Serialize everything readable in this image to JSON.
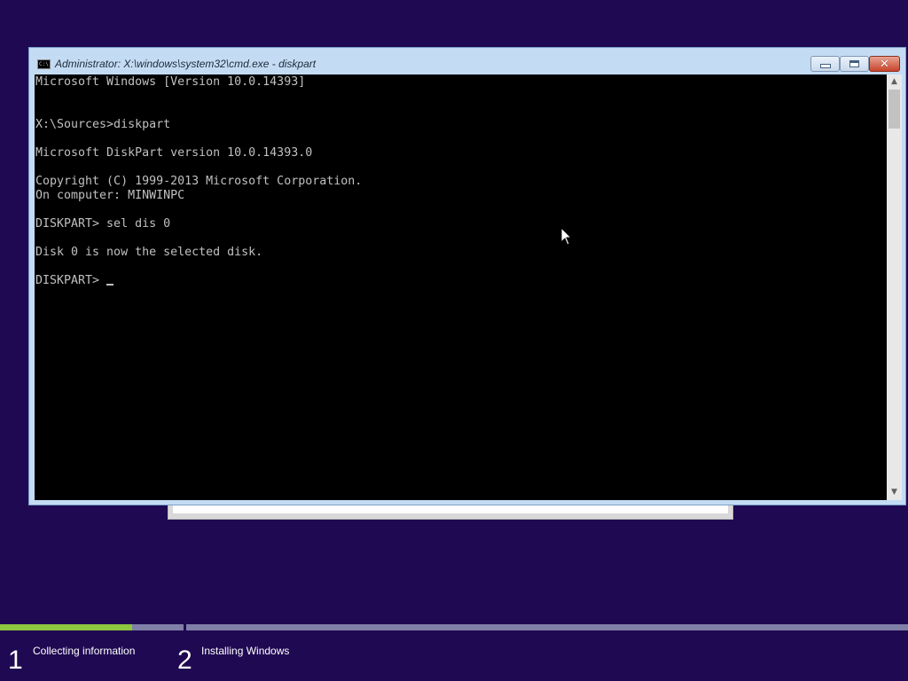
{
  "window": {
    "title": "Administrator: X:\\windows\\system32\\cmd.exe - diskpart",
    "icon": "cmd-icon",
    "icon_glyph": "C:\\"
  },
  "console": {
    "lines": [
      "Microsoft Windows [Version 10.0.14393]",
      "",
      "",
      "X:\\Sources>diskpart",
      "",
      "Microsoft DiskPart version 10.0.14393.0",
      "",
      "Copyright (C) 1999-2013 Microsoft Corporation.",
      "On computer: MINWINPC",
      "",
      "DISKPART> sel dis 0",
      "",
      "Disk 0 is now the selected disk.",
      "",
      "DISKPART> "
    ],
    "text_color": "#c0c0c0",
    "background": "#000000"
  },
  "setup": {
    "steps": [
      {
        "number": "1",
        "label": "Collecting information",
        "progress": 0.72
      },
      {
        "number": "2",
        "label": "Installing Windows",
        "progress": 0
      }
    ],
    "progress_color": "#8dc63f",
    "background": "#1f0952"
  }
}
